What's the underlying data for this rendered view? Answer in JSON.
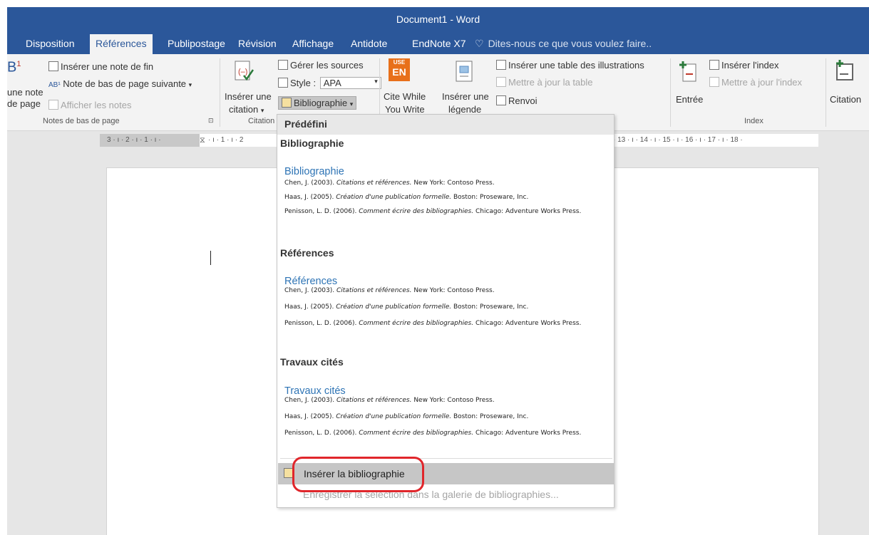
{
  "window": {
    "title": "Document1 - Word"
  },
  "tabs": [
    {
      "label": "Disposition"
    },
    {
      "label": "Références",
      "active": true
    },
    {
      "label": "Publipostage"
    },
    {
      "label": "Révision"
    },
    {
      "label": "Affichage"
    },
    {
      "label": "Antidote"
    },
    {
      "label": "EndNote X7"
    },
    {
      "label": "Dites-nous ce que vous voulez faire.."
    }
  ],
  "ribbon": {
    "footnotes": {
      "insert_footnote_partial_1": "une note",
      "insert_footnote_partial_2": "de page",
      "insert_endnote": "Insérer une note de fin",
      "next_footnote": "Note de bas de page suivante",
      "show_notes": "Afficher les notes",
      "group_label": "Notes de bas de page"
    },
    "citations": {
      "insert_citation_1": "Insérer une",
      "insert_citation_2": "citation",
      "manage_sources": "Gérer les sources",
      "style_label": "Style :",
      "style_value": "APA",
      "bibliography": "Bibliographie",
      "group_label": "Citation"
    },
    "cite_while_you_write": {
      "line1": "Cite While",
      "line2": "You Write",
      "icon_line1": "USE",
      "icon_line2": "EN"
    },
    "captions": {
      "insert_caption_1": "Insérer une",
      "insert_caption_2": "légende",
      "insert_table_of_figures": "Insérer une table des illustrations",
      "update_table": "Mettre à jour la table",
      "cross_reference": "Renvoi"
    },
    "index": {
      "mark_entry": "Entrée",
      "insert_index": "Insérer l'index",
      "update_index": "Mettre à jour l'index",
      "group_label": "Index"
    },
    "table_of_authorities": {
      "mark_citation": "Citation"
    }
  },
  "ruler": {
    "left_text": "3 · ı · 2 · ı · 1 · ı ·",
    "mid_text": "· ı · 1 · ı · 2",
    "right_text": "· 13 · ı · 14 · ı · 15 · ı · 16 · ı · 17 · ı · 18 ·"
  },
  "dropdown": {
    "header": "Prédéfini",
    "sections": [
      {
        "label": "Bibliographie",
        "title": "Bibliographie",
        "entries": [
          {
            "plain": "Chen, J. (2003). ",
            "italic": "Citations et références.",
            "rest": " New York: Contoso Press."
          },
          {
            "plain": "Haas, J. (2005). ",
            "italic": "Création d'une publication formelle.",
            "rest": " Boston: Proseware, Inc."
          },
          {
            "plain": "Penisson, L. D. (2006). ",
            "italic": "Comment écrire des bibliographies.",
            "rest": " Chicago: Adventure Works Press."
          }
        ]
      },
      {
        "label": "Références",
        "title": "Références",
        "entries": [
          {
            "plain": "Chen, J. (2003). ",
            "italic": "Citations et références.",
            "rest": " New York: Contoso Press."
          },
          {
            "plain": "Haas, J. (2005). ",
            "italic": "Création d'une publication formelle.",
            "rest": " Boston: Proseware, Inc."
          },
          {
            "plain": "Penisson, L. D. (2006). ",
            "italic": "Comment écrire des bibliographies.",
            "rest": " Chicago: Adventure Works Press."
          }
        ]
      },
      {
        "label": "Travaux cités",
        "title": "Travaux cités",
        "entries": [
          {
            "plain": "Chen, J. (2003). ",
            "italic": "Citations et références.",
            "rest": " New York: Contoso Press."
          },
          {
            "plain": "Haas, J. (2005). ",
            "italic": "Création d'une publication formelle.",
            "rest": " Boston: Proseware, Inc."
          },
          {
            "plain": "Penisson, L. D. (2006). ",
            "italic": "Comment écrire des bibliographies.",
            "rest": " Chicago: Adventure Works Press."
          }
        ]
      }
    ],
    "insert_bibliography": "Insérer la bibliographie",
    "save_selection": "Enregistrer la sélection dans la galerie de bibliographies..."
  },
  "colors": {
    "word_blue": "#2b579a",
    "link_blue": "#2e74b5",
    "highlight_red": "#e0262b"
  }
}
